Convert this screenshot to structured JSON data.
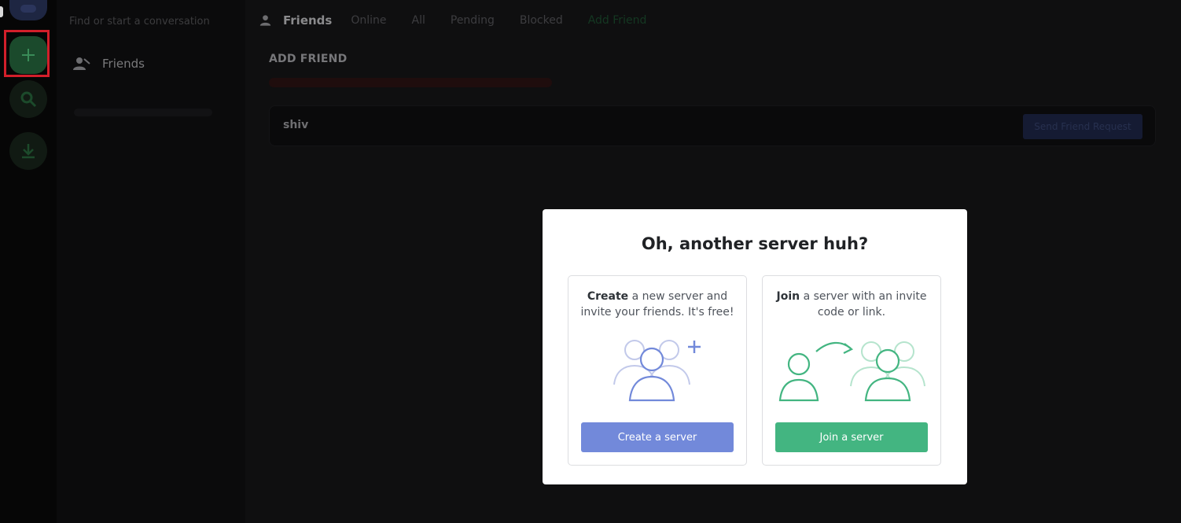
{
  "side": {
    "search_placeholder": "Find or start a conversation",
    "friends_label": "Friends"
  },
  "tabs": {
    "friends": "Friends",
    "items": [
      "Online",
      "All",
      "Pending",
      "Blocked",
      "Add Friend"
    ]
  },
  "add_friend": {
    "title": "ADD FRIEND",
    "input_value": "shiv",
    "send_button": "Send Friend Request"
  },
  "modal": {
    "title": "Oh, another server huh?",
    "create": {
      "bold": "Create",
      "text": " a new server and invite your friends. It's free!",
      "button": "Create a server"
    },
    "join": {
      "bold": "Join",
      "text": " a server with an invite code or link.",
      "button": "Join a server"
    }
  },
  "colors": {
    "create_accent": "#7289da",
    "join_accent": "#43b581",
    "highlight": "#d21f2a"
  }
}
